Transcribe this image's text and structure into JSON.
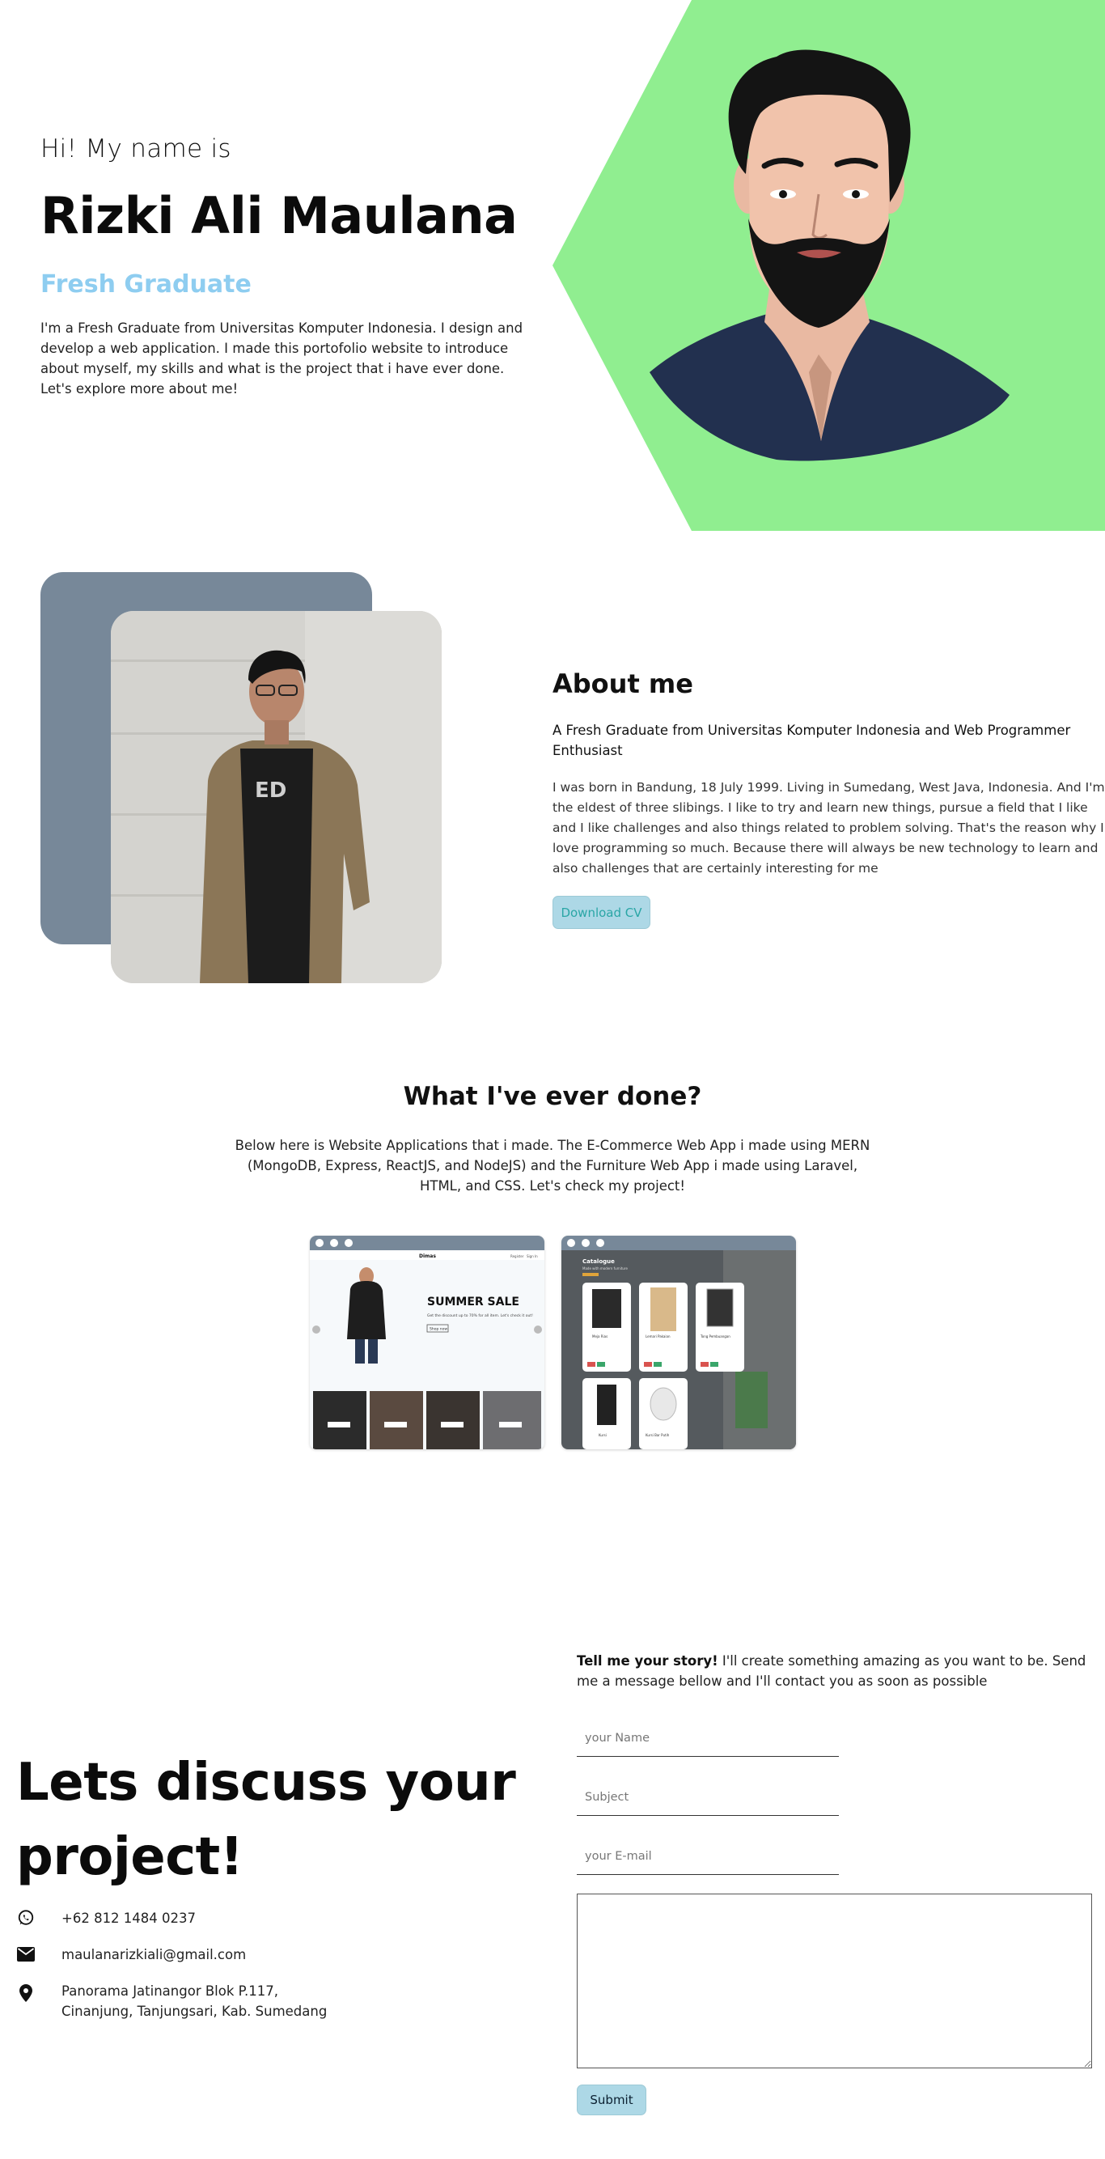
{
  "hero": {
    "greeting": "Hi! My name is",
    "name": "Rizki Ali Maulana",
    "role": "Fresh Graduate",
    "description": "I'm a Fresh Graduate from Universitas Komputer Indonesia. I design and develop a web application. I made this portofolio website to introduce about myself, my skills and what is the project that i have ever done. Let's explore more about me!",
    "accent_color": "#90ee90"
  },
  "about": {
    "title": "About me",
    "subtitle": "A Fresh Graduate from Universitas Komputer Indonesia and Web Programmer Enthusiast",
    "body": "I was born in Bandung, 18 July 1999. Living in Sumedang, West Java, Indonesia. And I'm the eldest of three slibings. I like to try and learn new things, pursue a field that I like and I like challenges and also things related to problem solving. That's the reason why I love programming so much. Because there will always be new technology to learn and also challenges that are certainly interesting for me",
    "button_label": "Download CV",
    "frame_color": "#778899"
  },
  "projects": {
    "title": "What I've ever done?",
    "description": "Below here is Website Applications that i made. The E-Commerce Web App i made using MERN (MongoDB, Express, ReactJS, and NodeJS) and the Furniture Web App i made using Laravel, HTML, and CSS. Let's check my project!",
    "ecommerce": {
      "brand": "Dimas",
      "hero_title": "SUMMER SALE",
      "hero_text": "Get the discount up to 70% for all item. Let's check it out!",
      "shop_label": "Shop now",
      "nav": [
        "Register",
        "Sign In"
      ]
    },
    "furniture": {
      "heading": "Catalogue",
      "subheading": "Made with modern furniture",
      "items": [
        "Meja Rias",
        "Lemari Pakaian",
        "Tong Pembuangan",
        "Kursi",
        "Kursi Bar Putih"
      ]
    }
  },
  "contact": {
    "title": "Lets discuss your project!",
    "phone": "+62 812 1484 0237",
    "email": "maulanarizkiali@gmail.com",
    "address": "Panorama Jatinangor Blok P.117, Cinanjung, Tanjungsari, Kab. Sumedang",
    "intro_bold": "Tell me your story!",
    "intro_text": " I'll create something amazing as you want to be. Send me a message bellow and I'll contact you as soon as possible",
    "name_placeholder": "your Name",
    "subject_placeholder": "Subject",
    "email_placeholder": "your E-mail",
    "submit_label": "Submit",
    "button_color": "#add8e6"
  }
}
